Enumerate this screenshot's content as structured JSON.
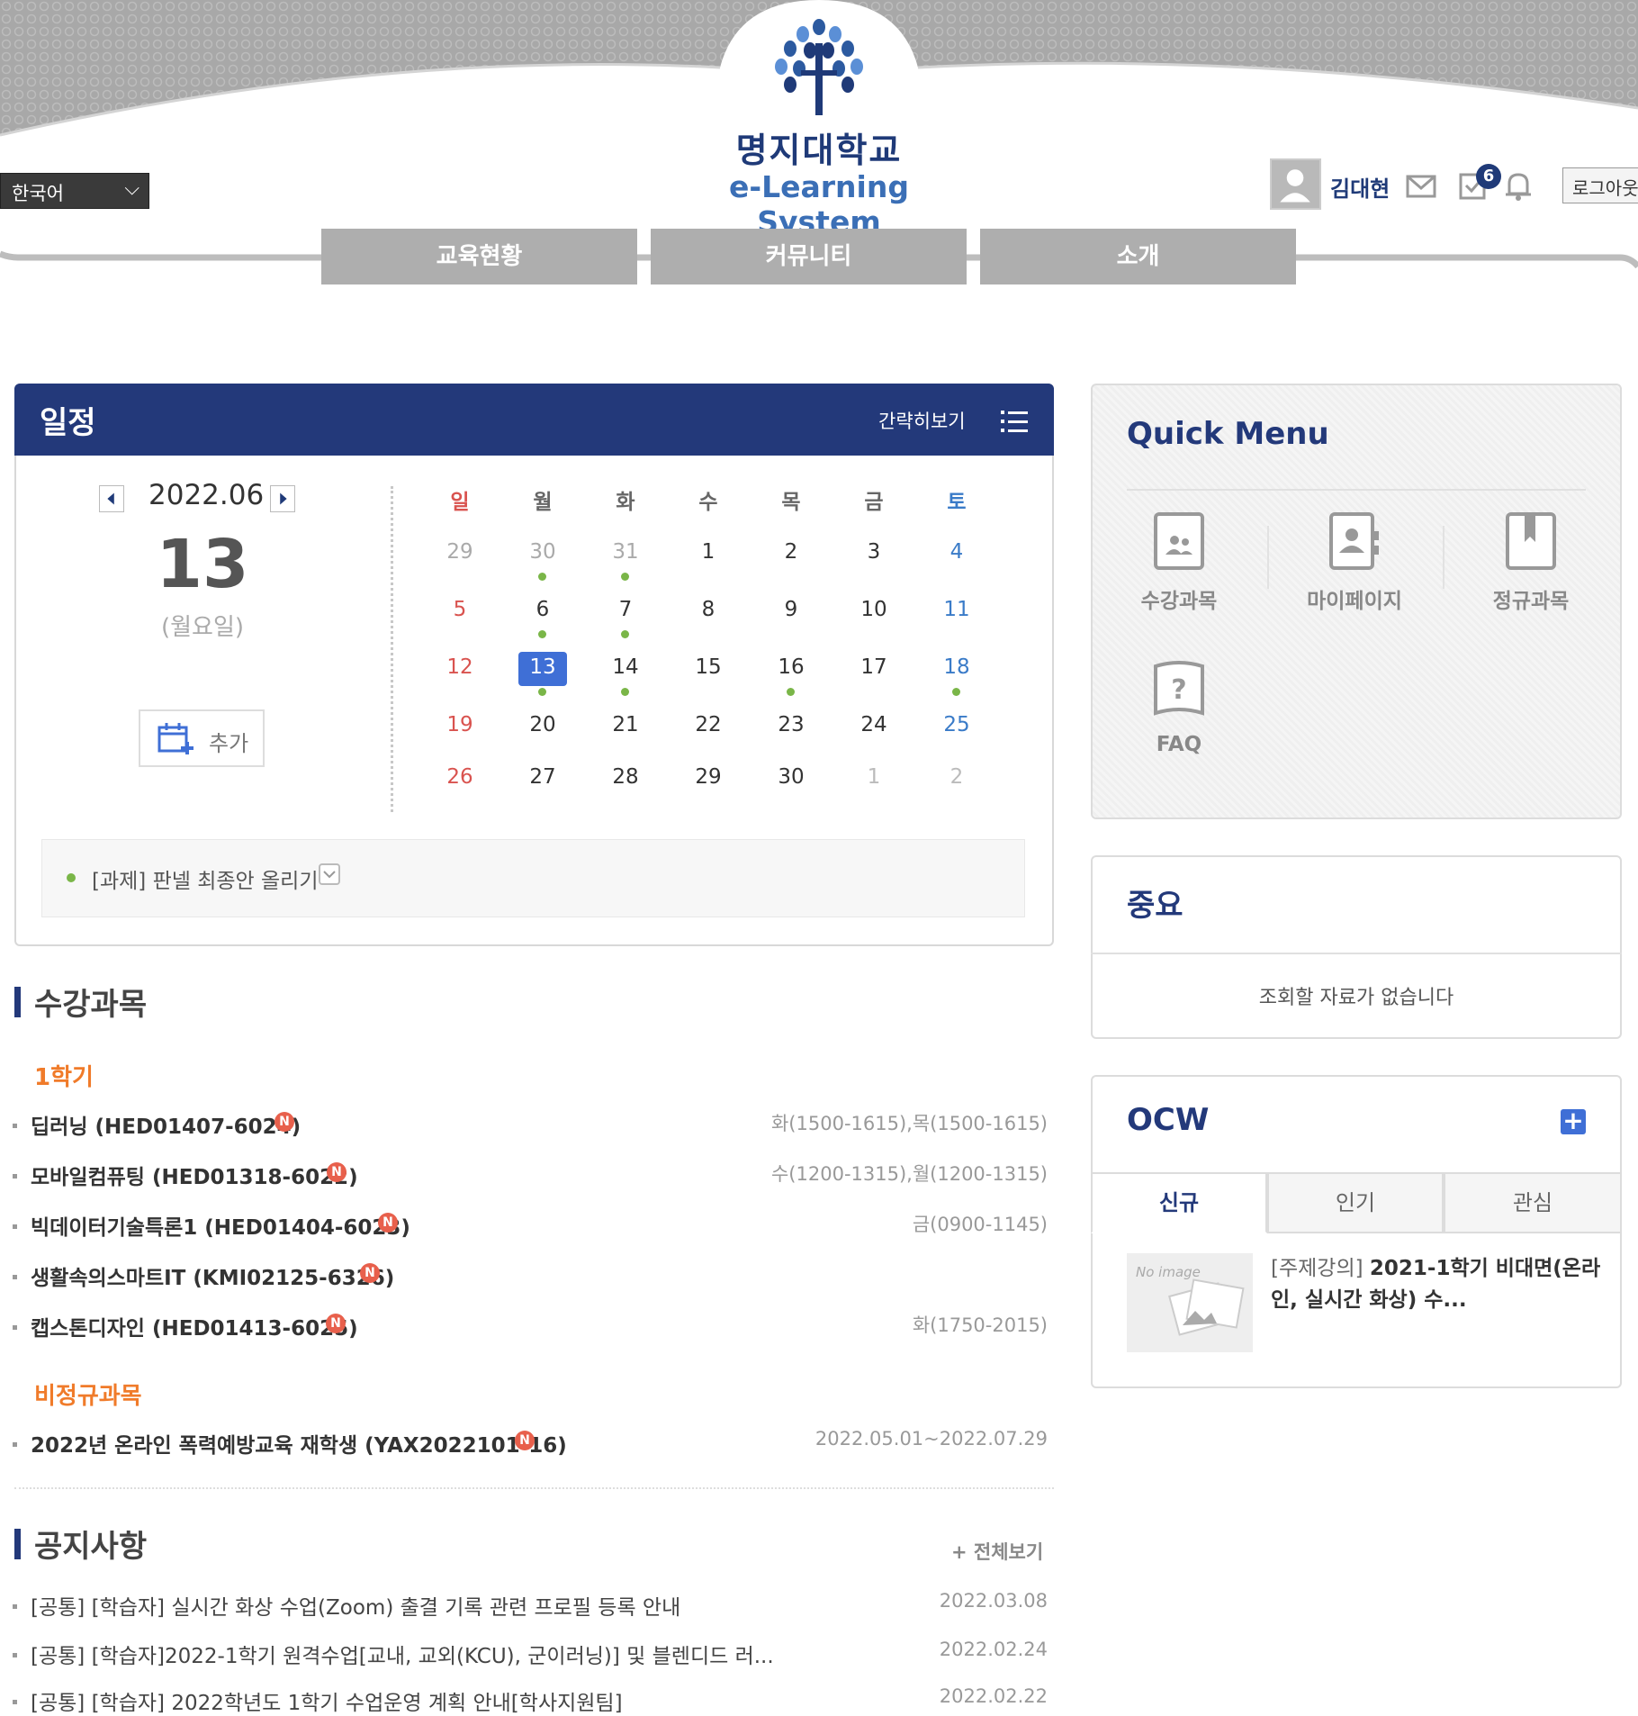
{
  "header": {
    "logo_title": "명지대학교",
    "logo_sub": "e-Learning System",
    "language": "한국어",
    "user_name": "김대현",
    "notification_count": "6",
    "logout_label": "로그아웃",
    "nav": [
      "교육현황",
      "커뮤니티",
      "소개"
    ]
  },
  "schedule": {
    "title": "일정",
    "brief_view": "간략히보기",
    "month": "2022.06",
    "day": "13",
    "weekday": "(월요일)",
    "add_label": "추가",
    "weekdays": [
      "일",
      "월",
      "화",
      "수",
      "목",
      "금",
      "토"
    ],
    "weeks": [
      [
        "29",
        "30",
        "31",
        "1",
        "2",
        "3",
        "4"
      ],
      [
        "5",
        "6",
        "7",
        "8",
        "9",
        "10",
        "11"
      ],
      [
        "12",
        "13",
        "14",
        "15",
        "16",
        "17",
        "18"
      ],
      [
        "19",
        "20",
        "21",
        "22",
        "23",
        "24",
        "25"
      ],
      [
        "26",
        "27",
        "28",
        "29",
        "30",
        "1",
        "2"
      ]
    ],
    "event": "[과제] 판넬 최종안 올리기"
  },
  "courses": {
    "title": "수강과목",
    "semester1_label": "1학기",
    "semester1": [
      {
        "name": "딥러닝 (HED01407-6024)",
        "time": "화(1500-1615),목(1500-1615)"
      },
      {
        "name": "모바일컴퓨팅 (HED01318-6022)",
        "time": "수(1200-1315),월(1200-1315)"
      },
      {
        "name": "빅데이터기술특론1 (HED01404-6023)",
        "time": "금(0900-1145)"
      },
      {
        "name": "생활속의스마트IT (KMI02125-6326)",
        "time": ""
      },
      {
        "name": "캡스톤디자인 (HED01413-6025)",
        "time": "화(1750-2015)"
      }
    ],
    "irregular_label": "비정규과목",
    "irregular": [
      {
        "name": "2022년 온라인 폭력예방교육 재학생 (YAX2022101-16)",
        "time": "2022.05.01~2022.07.29"
      }
    ],
    "new_badge": "N"
  },
  "notices": {
    "title": "공지사항",
    "view_all": "+ 전체보기",
    "items": [
      {
        "text": "[공통] [학습자] 실시간 화상 수업(Zoom) 출결 기록 관련 프로필 등록 안내",
        "date": "2022.03.08"
      },
      {
        "text": "[공통] [학습자]2022-1학기 원격수업[교내, 교외(KCU), 군이러닝)] 및 블렌디드 러...",
        "date": "2022.02.24"
      },
      {
        "text": "[공통] [학습자] 2022학년도 1학기 수업운영 계획 안내[학사지원팀]",
        "date": "2022.02.22"
      }
    ]
  },
  "quick_menu": {
    "title": "Quick Menu",
    "items": [
      "수강과목",
      "마이페이지",
      "정규과목",
      "FAQ"
    ]
  },
  "important": {
    "title": "중요",
    "empty": "조회할 자료가 없습니다"
  },
  "ocw": {
    "title": "OCW",
    "tabs": [
      "신규",
      "인기",
      "관심"
    ],
    "no_image": "No image",
    "item_prefix": "[주제강의]",
    "item_title": "2021-1학기 비대면(온라인, 실시간 화상) 수..."
  }
}
